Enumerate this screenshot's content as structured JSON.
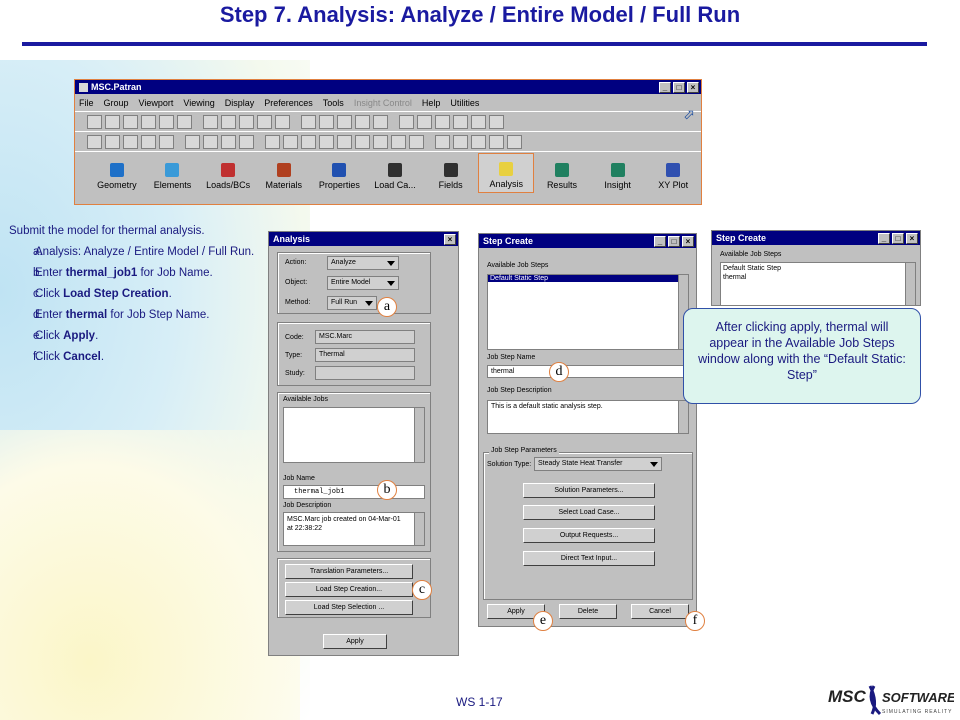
{
  "slide": {
    "title": "Step 7. Analysis: Analyze / Entire Model / Full Run",
    "footer": "WS 1-17"
  },
  "patran": {
    "title": "MSC.Patran",
    "menu": [
      "File",
      "Group",
      "Viewport",
      "Viewing",
      "Display",
      "Preferences",
      "Tools",
      "Insight Control",
      "Help",
      "Utilities"
    ],
    "apps": [
      "Geometry",
      "Elements",
      "Loads/BCs",
      "Materials",
      "Properties",
      "Load Ca...",
      "Fields",
      "Analysis",
      "Results",
      "Insight",
      "XY Plot"
    ],
    "app_colors": [
      "#1e70c8",
      "#3a9ad8",
      "#c03030",
      "#b04020",
      "#2050b0",
      "#303030",
      "#303030",
      "#e8d040",
      "#208060",
      "#208060",
      "#3050b0"
    ],
    "selected_app": "Analysis"
  },
  "instructions": {
    "lead": "Submit the model for thermal analysis.",
    "steps": [
      {
        "letter": "a.",
        "pre": "Analysis: Analyze / Entire Model / Full Run.",
        "bold": "",
        "post": ""
      },
      {
        "letter": "b.",
        "pre": "Enter ",
        "bold": "thermal_job1",
        "post": " for Job Name."
      },
      {
        "letter": "c.",
        "pre": "Click ",
        "bold": "Load Step Creation",
        "post": "."
      },
      {
        "letter": "d.",
        "pre": "Enter ",
        "bold": "thermal",
        "post": " for Job Step Name."
      },
      {
        "letter": "e.",
        "pre": "Click ",
        "bold": "Apply",
        "post": "."
      },
      {
        "letter": "f.",
        "pre": "Click ",
        "bold": "Cancel",
        "post": "."
      }
    ]
  },
  "analysis_dialog": {
    "title": "Analysis",
    "action_label": "Action:",
    "action_value": "Analyze",
    "object_label": "Object:",
    "object_value": "Entire Model",
    "method_label": "Method:",
    "method_value": "Full Run",
    "code_label": "Code:",
    "code_value": "MSC.Marc",
    "type_label": "Type:",
    "type_value": "Thermal",
    "study_label": "Study:",
    "available_jobs_label": "Available Jobs",
    "job_name_label": "Job Name",
    "job_name_value": "thermal_job1",
    "job_desc_label": "Job Description",
    "job_desc_line1": "MSC.Marc job created on 04-Mar-01",
    "job_desc_line2": "at 22:38:22",
    "btn_translation": "Translation Parameters...",
    "btn_load_step_creation": "Load Step Creation...",
    "btn_load_step_selection": "Load Step Selection ...",
    "btn_apply": "Apply"
  },
  "step_create_dialog": {
    "title": "Step Create",
    "available_steps_label": "Available Job Steps",
    "available_step_1": "Default Static Step",
    "job_step_name_label": "Job Step Name",
    "job_step_name_value": "thermal",
    "job_step_desc_label": "Job Step Description",
    "job_step_desc_value": "This is a default static analysis step.",
    "params_label": "Job Step Parameters",
    "solution_type_label": "Solution Type:",
    "solution_type_value": "Steady State Heat Transfer",
    "btn_solution_params": "Solution Parameters...",
    "btn_select_load_case": "Select Load Case...",
    "btn_output_requests": "Output Requests...",
    "btn_direct_text": "Direct Text Input...",
    "btn_apply": "Apply",
    "btn_delete": "Delete",
    "btn_cancel": "Cancel"
  },
  "step_create_result": {
    "title": "Step Create",
    "available_steps_label": "Available Job Steps",
    "step_1": "Default Static Step",
    "step_2": "thermal"
  },
  "callout": {
    "text": "After clicking apply, thermal will appear in the Available Job Steps window along with the “Default Static: Step”"
  },
  "markers": [
    "a",
    "b",
    "c",
    "d",
    "e",
    "f"
  ],
  "logo": {
    "text_1": "MSC",
    "text_2": "SOFTWARE",
    "tagline": "SIMULATING REALITY"
  }
}
